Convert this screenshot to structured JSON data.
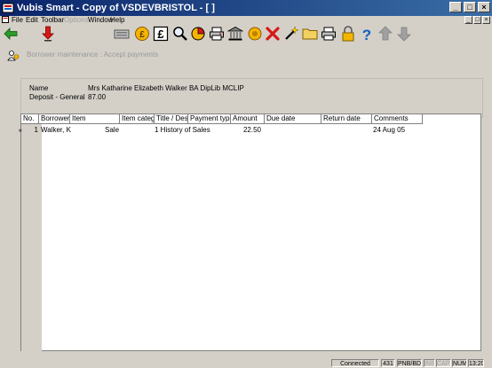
{
  "window": {
    "title": "Vubis Smart - Copy of VSDEVBRISTOL - [ ]",
    "buttons": [
      "_",
      "□",
      "×"
    ]
  },
  "menubar": {
    "items": [
      {
        "label": "File",
        "enabled": true
      },
      {
        "label": "Edit",
        "enabled": true
      },
      {
        "label": "Toolbar",
        "enabled": true
      },
      {
        "label": "Options",
        "enabled": false
      },
      {
        "label": "Window",
        "enabled": true
      },
      {
        "label": "Help",
        "enabled": true
      }
    ],
    "mdi_buttons": [
      "_",
      "□",
      "×"
    ]
  },
  "toolbar": {
    "icons": [
      "back-arrow-icon",
      "down-arrow-icon",
      "card-reader-icon",
      "coin-icon",
      "pound-icon",
      "magnifier-icon",
      "pie-chart-icon",
      "printer-icon",
      "bank-icon",
      "settings-coin-icon",
      "delete-x-icon",
      "wand-icon",
      "folder-icon",
      "print-icon",
      "lock-icon",
      "help-icon",
      "up-arrow-icon",
      "down-arrow-grey-icon"
    ]
  },
  "screen": {
    "title": "Borrower maintenance : Accept payments"
  },
  "info": {
    "name_label": "Name",
    "name_value": "Mrs Katharine Elizabeth Walker BA DipLib MCLIP",
    "deposit_label": "Deposit - General",
    "deposit_value": "87.00"
  },
  "grid": {
    "columns": [
      "No.",
      "Borrower",
      "Item",
      "Item categ",
      "Title / Desc",
      "Payment type",
      "Amount",
      "Due date",
      "Return date",
      "Comments"
    ],
    "rows": [
      {
        "no": "1",
        "borrower": "Walker, K",
        "item": "",
        "item_category": "Sale",
        "title": "1 History of Sales",
        "payment_type": "",
        "amount": "22.50",
        "due_date": "",
        "return_date": "",
        "comments": "24 Aug 05"
      }
    ]
  },
  "statusbar": {
    "connection": "Connected",
    "code": "431",
    "location": "PNB/BD",
    "ins": "INS",
    "caps": "CAPS",
    "num": "NUM",
    "time": "13:20"
  },
  "colors": {
    "titlebar_start": "#0a246a",
    "titlebar_end": "#3a6ea5",
    "face": "#d4d0c8"
  }
}
